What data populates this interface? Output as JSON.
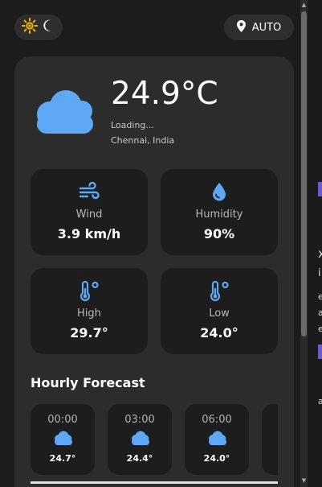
{
  "theme": {
    "light_icon": "sun-icon",
    "dark_icon": "moon-icon"
  },
  "location_button": {
    "label": "AUTO",
    "icon": "location-pin-icon"
  },
  "current": {
    "icon": "cloud-icon",
    "temperature": "24.9°C",
    "status": "Loading...",
    "location": "Chennai, India"
  },
  "stats": [
    {
      "icon": "wind-icon",
      "label": "Wind",
      "value": "3.9 km/h"
    },
    {
      "icon": "humidity-drop-icon",
      "label": "Humidity",
      "value": "90%"
    },
    {
      "icon": "thermometer-icon",
      "label": "High",
      "value": "29.7°"
    },
    {
      "icon": "thermometer-icon",
      "label": "Low",
      "value": "24.0°"
    }
  ],
  "hourly": {
    "title": "Hourly Forecast",
    "items": [
      {
        "time": "00:00",
        "icon": "cloud-icon",
        "temp": "24.7°"
      },
      {
        "time": "03:00",
        "icon": "cloud-icon",
        "temp": "24.4°"
      },
      {
        "time": "06:00",
        "icon": "cloud-icon",
        "temp": "24.0°"
      }
    ]
  },
  "colors": {
    "accent": "#5fa8f5",
    "sun": "#f5b700",
    "card": "#2c2c2c",
    "tile": "#1d1d1d"
  },
  "background_glyphs": [
    "x",
    "i",
    "e",
    "a",
    "e",
    "a"
  ]
}
